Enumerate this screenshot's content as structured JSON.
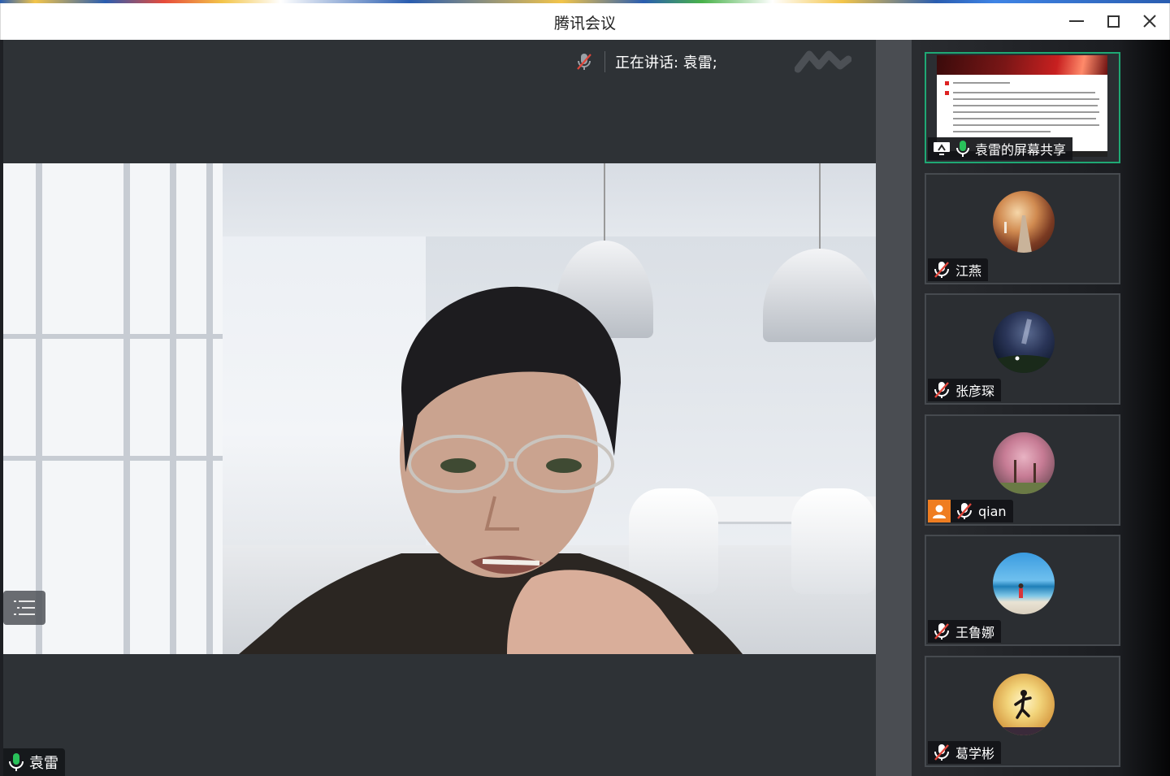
{
  "window": {
    "title": "腾讯会议"
  },
  "main": {
    "speaking_label": "正在讲话: 袁雷;",
    "speaker_name": "袁雷"
  },
  "sidebar": {
    "screen_share_label": "袁雷的屏幕共享",
    "participants": [
      {
        "name": "江燕",
        "muted": true,
        "avatar": "road-avatar"
      },
      {
        "name": "张彦琛",
        "muted": true,
        "avatar": "night-sky-avatar"
      },
      {
        "name": "qian",
        "muted": true,
        "avatar": "blossom-tree-avatar",
        "badge": "user-icon"
      },
      {
        "name": "王鲁娜",
        "muted": true,
        "avatar": "beach-avatar"
      },
      {
        "name": "葛学彬",
        "muted": true,
        "avatar": "runner-sunset-avatar"
      }
    ]
  },
  "colors": {
    "active_border": "#1fa874",
    "mic_on": "#29c15a",
    "mic_muted_slash": "#e0453a",
    "badge": "#ef7d21"
  }
}
